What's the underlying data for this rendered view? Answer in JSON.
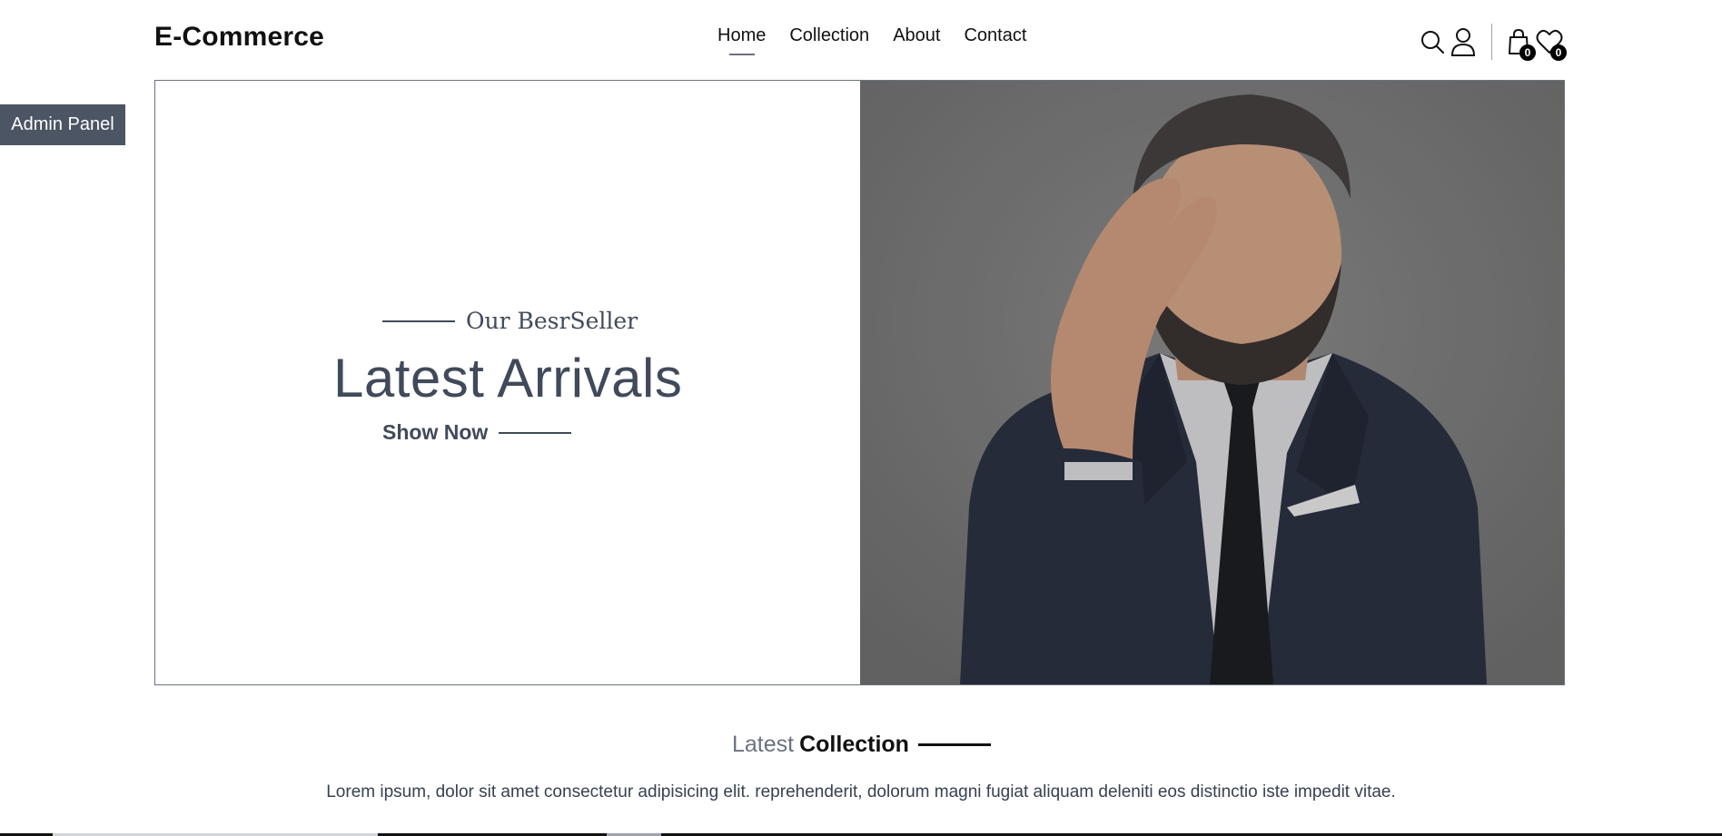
{
  "header": {
    "logo": "E-Commerce",
    "nav": [
      {
        "label": "Home",
        "active": true
      },
      {
        "label": "Collection",
        "active": false
      },
      {
        "label": "About",
        "active": false
      },
      {
        "label": "Contact",
        "active": false
      }
    ],
    "icons": [
      "search-icon",
      "user-icon",
      "cart-icon",
      "heart-icon"
    ],
    "cart_count": "0",
    "wishlist_count": "0"
  },
  "admin_panel": {
    "label": "Admin Panel"
  },
  "hero": {
    "kicker": "Our BesrSeller",
    "title": "Latest Arrivals",
    "cta": "Show Now",
    "image": "man-in-suit-photo"
  },
  "latest": {
    "word1": "Latest",
    "word2": "Collection",
    "description": "Lorem ipsum, dolor sit amet consectetur adipisicing elit. reprehenderit, dolorum magni fugiat aliquam deleniti eos distinctio iste impedit vitae."
  },
  "colors": {
    "text_dark": "#111111",
    "text_slate": "#414a5a",
    "admin_bg": "#4b5563",
    "hero_photo_bg": "#7a7a7a"
  }
}
